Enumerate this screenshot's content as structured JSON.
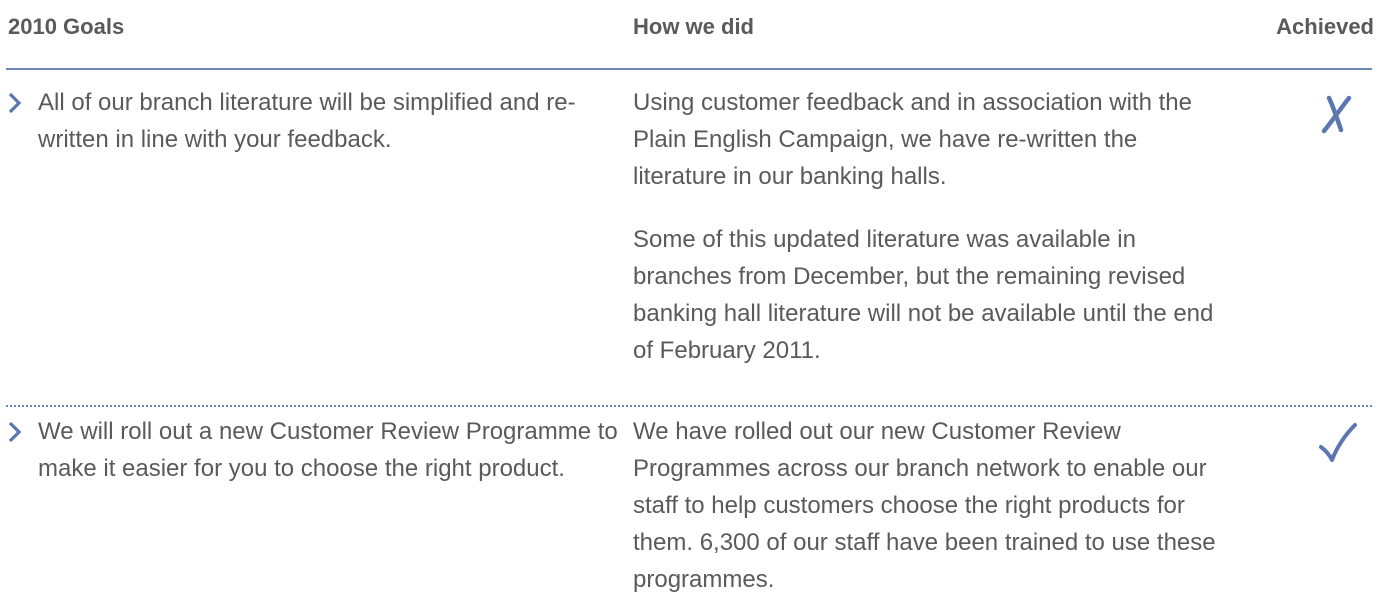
{
  "header": {
    "goals_label": "2010 Goals",
    "how_label": "How we did",
    "achieved_label": "Achieved"
  },
  "colors": {
    "accent": "#5b76b0",
    "text": "#5a5a5a"
  },
  "rows": [
    {
      "goal": "All of our branch literature will be simplified and re-written in line with your feedback.",
      "how": [
        "Using customer feedback and in association with the Plain English Campaign, we have re-written the literature in our banking halls.",
        "Some of this updated literature was available in branches from December, but the remaining revised banking hall literature will not be available until the end of February 2011."
      ],
      "achieved_icon": "cross-icon",
      "achieved": false
    },
    {
      "goal": "We will roll out a new Customer Review Programme to make it easier for you to choose the right product.",
      "how": [
        "We have rolled out our new Customer Review Programmes across our branch network to enable our staff to help customers choose the right products for them. 6,300 of our staff have been trained to use these programmes."
      ],
      "achieved_icon": "check-icon",
      "achieved": true
    }
  ]
}
